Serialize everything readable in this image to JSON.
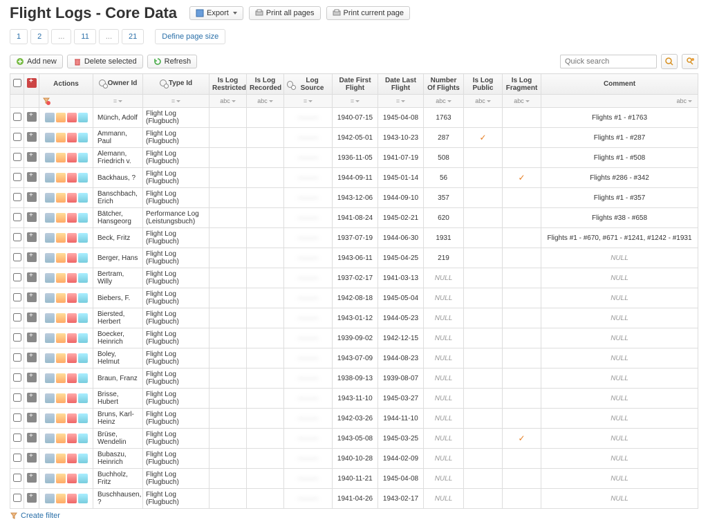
{
  "header": {
    "title": "Flight Logs - Core Data",
    "export_btn": "Export",
    "print_all_btn": "Print all pages",
    "print_current_btn": "Print current page"
  },
  "pagination": {
    "pages": [
      "1",
      "2",
      "...",
      "11",
      "...",
      "21"
    ],
    "define_label": "Define page size"
  },
  "toolbar": {
    "add_new": "Add new",
    "delete_selected": "Delete selected",
    "refresh": "Refresh",
    "quick_search_placeholder": "Quick search"
  },
  "columns": {
    "actions": "Actions",
    "owner": "Owner Id",
    "type": "Type Id",
    "restricted": "Is Log Restricted",
    "recorded": "Is Log Recorded",
    "source": "Log Source",
    "date_first": "Date First Flight",
    "date_last": "Date Last Flight",
    "num_flights": "Number Of Flights",
    "public": "Is Log Public",
    "fragment": "Is Log Fragment",
    "comment": "Comment"
  },
  "filter_labels": {
    "eq": "=",
    "abc": "abc"
  },
  "create_filter": "Create filter",
  "rows": [
    {
      "owner": "Münch, Adolf",
      "type": "Flight Log (Flugbuch)",
      "dff": "1940-07-15",
      "dlf": "1945-04-08",
      "n": "1763",
      "pub": "",
      "frag": "",
      "comment": "Flights #1 - #1763"
    },
    {
      "owner": "Ammann, Paul",
      "type": "Flight Log (Flugbuch)",
      "dff": "1942-05-01",
      "dlf": "1943-10-23",
      "n": "287",
      "pub": "✓",
      "frag": "",
      "comment": "Flights #1 - #287"
    },
    {
      "owner": "Alemann, Friedrich v.",
      "type": "Flight Log (Flugbuch)",
      "dff": "1936-11-05",
      "dlf": "1941-07-19",
      "n": "508",
      "pub": "",
      "frag": "",
      "comment": "Flights #1 - #508"
    },
    {
      "owner": "Backhaus, ?",
      "type": "Flight Log (Flugbuch)",
      "dff": "1944-09-11",
      "dlf": "1945-01-14",
      "n": "56",
      "pub": "",
      "frag": "✓",
      "comment": "Flights #286 - #342"
    },
    {
      "owner": "Banschbach, Erich",
      "type": "Flight Log (Flugbuch)",
      "dff": "1943-12-06",
      "dlf": "1944-09-10",
      "n": "357",
      "pub": "",
      "frag": "",
      "comment": "Flights #1 - #357"
    },
    {
      "owner": "Bätcher, Hansgeorg",
      "type": "Performance Log (Leistungsbuch)",
      "dff": "1941-08-24",
      "dlf": "1945-02-21",
      "n": "620",
      "pub": "",
      "frag": "",
      "comment": "Flights #38 - #658"
    },
    {
      "owner": "Beck, Fritz",
      "type": "Flight Log (Flugbuch)",
      "dff": "1937-07-19",
      "dlf": "1944-06-30",
      "n": "1931",
      "pub": "",
      "frag": "",
      "comment": "Flights #1 - #670, #671 - #1241, #1242 - #1931"
    },
    {
      "owner": "Berger, Hans",
      "type": "Flight Log (Flugbuch)",
      "dff": "1943-06-11",
      "dlf": "1945-04-25",
      "n": "219",
      "pub": "",
      "frag": "",
      "comment": "NULL"
    },
    {
      "owner": "Bertram, Willy",
      "type": "Flight Log (Flugbuch)",
      "dff": "1937-02-17",
      "dlf": "1941-03-13",
      "n": "NULL",
      "pub": "",
      "frag": "",
      "comment": "NULL"
    },
    {
      "owner": "Biebers, F.",
      "type": "Flight Log (Flugbuch)",
      "dff": "1942-08-18",
      "dlf": "1945-05-04",
      "n": "NULL",
      "pub": "",
      "frag": "",
      "comment": "NULL"
    },
    {
      "owner": "Biersted, Herbert",
      "type": "Flight Log (Flugbuch)",
      "dff": "1943-01-12",
      "dlf": "1944-05-23",
      "n": "NULL",
      "pub": "",
      "frag": "",
      "comment": "NULL"
    },
    {
      "owner": "Boecker, Heinrich",
      "type": "Flight Log (Flugbuch)",
      "dff": "1939-09-02",
      "dlf": "1942-12-15",
      "n": "NULL",
      "pub": "",
      "frag": "",
      "comment": "NULL"
    },
    {
      "owner": "Boley, Helmut",
      "type": "Flight Log (Flugbuch)",
      "dff": "1943-07-09",
      "dlf": "1944-08-23",
      "n": "NULL",
      "pub": "",
      "frag": "",
      "comment": "NULL"
    },
    {
      "owner": "Braun, Franz",
      "type": "Flight Log (Flugbuch)",
      "dff": "1938-09-13",
      "dlf": "1939-08-07",
      "n": "NULL",
      "pub": "",
      "frag": "",
      "comment": "NULL"
    },
    {
      "owner": "Brisse, Hubert",
      "type": "Flight Log (Flugbuch)",
      "dff": "1943-11-10",
      "dlf": "1945-03-27",
      "n": "NULL",
      "pub": "",
      "frag": "",
      "comment": "NULL"
    },
    {
      "owner": "Bruns, Karl-Heinz",
      "type": "Flight Log (Flugbuch)",
      "dff": "1942-03-26",
      "dlf": "1944-11-10",
      "n": "NULL",
      "pub": "",
      "frag": "",
      "comment": "NULL"
    },
    {
      "owner": "Brüse, Wendelin",
      "type": "Flight Log (Flugbuch)",
      "dff": "1943-05-08",
      "dlf": "1945-03-25",
      "n": "NULL",
      "pub": "",
      "frag": "✓",
      "comment": "NULL"
    },
    {
      "owner": "Bubaszu, Heinrich",
      "type": "Flight Log (Flugbuch)",
      "dff": "1940-10-28",
      "dlf": "1944-02-09",
      "n": "NULL",
      "pub": "",
      "frag": "",
      "comment": "NULL"
    },
    {
      "owner": "Buchholz, Fritz",
      "type": "Flight Log (Flugbuch)",
      "dff": "1940-11-21",
      "dlf": "1945-04-08",
      "n": "NULL",
      "pub": "",
      "frag": "",
      "comment": "NULL"
    },
    {
      "owner": "Buschhausen, ?",
      "type": "Flight Log (Flugbuch)",
      "dff": "1941-04-26",
      "dlf": "1943-02-17",
      "n": "NULL",
      "pub": "",
      "frag": "",
      "comment": "NULL"
    }
  ]
}
